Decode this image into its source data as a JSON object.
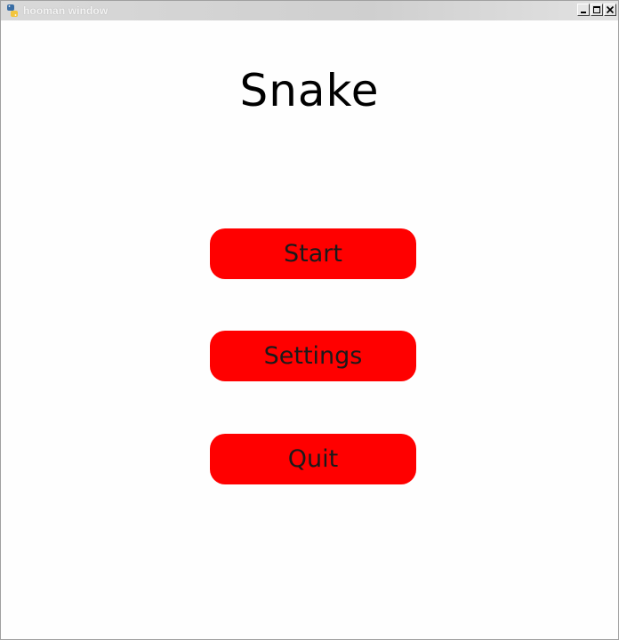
{
  "window": {
    "title": "hooman window",
    "icon": "python-snake-icon"
  },
  "colors": {
    "button_fill": "#ff0000",
    "background": "#fefefe",
    "text": "#000000"
  },
  "game": {
    "title": "Snake"
  },
  "menu": {
    "start_label": "Start",
    "settings_label": "Settings",
    "quit_label": "Quit"
  }
}
